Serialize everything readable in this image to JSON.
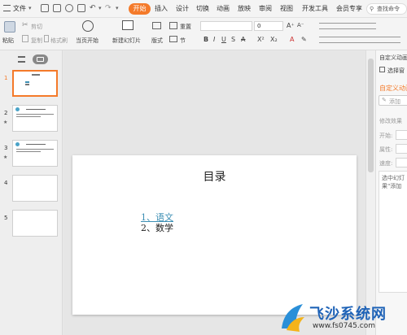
{
  "menubar": {
    "file": "文件",
    "tabs": [
      "开始",
      "插入",
      "设计",
      "切换",
      "动画",
      "放映",
      "审阅",
      "视图",
      "开发工具",
      "会员专享"
    ],
    "search": "查找命令"
  },
  "ribbon": {
    "paste": "粘贴",
    "cut": "剪切",
    "copy": "复制",
    "format_painter": "格式刷",
    "play_current": "当页开始",
    "new_slide": "新建幻灯片",
    "layout": "版式",
    "section": "节",
    "reset": "重置",
    "font_size": "0"
  },
  "slides": [
    {
      "num": "1",
      "selected": true
    },
    {
      "num": "2",
      "star": "★"
    },
    {
      "num": "3",
      "star": "★"
    },
    {
      "num": "4"
    },
    {
      "num": "5"
    }
  ],
  "slide": {
    "title": "目录",
    "item1": "1、语文",
    "item2": "2、数学"
  },
  "right_panel": {
    "header": "自定义动画",
    "select_pane": "选择窗",
    "title": "自定义动画",
    "add_effect": "添加",
    "modify": "修改效果",
    "start": "开始:",
    "property": "属性:",
    "speed": "速度:",
    "hint": "选中幻灯\n果\"添加"
  },
  "watermark": {
    "name": "飞沙系统网",
    "url": "www.fs0745.com"
  },
  "colors": {
    "accent": "#f47a2a",
    "link": "#3d8fb4"
  }
}
